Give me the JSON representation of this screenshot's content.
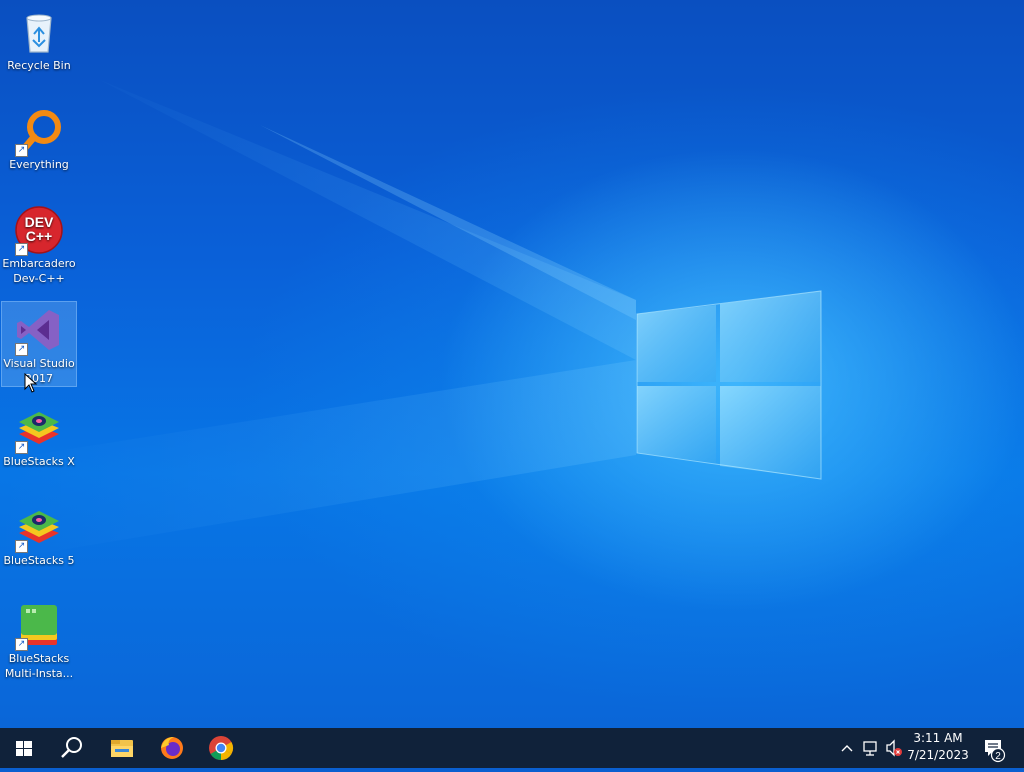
{
  "desktop": {
    "icons": [
      {
        "label": "Recycle Bin",
        "icon": "recycle-bin-icon",
        "shortcut": false
      },
      {
        "label": "Everything",
        "icon": "everything-search-icon",
        "shortcut": true
      },
      {
        "label": "Embarcadero Dev-C++",
        "icon_text": "DEV C++",
        "icon": "devcpp-icon",
        "shortcut": true
      },
      {
        "label": "Visual Studio 2017",
        "icon": "visual-studio-icon",
        "shortcut": true,
        "selected": true
      },
      {
        "label": "BlueStacks X",
        "icon": "bluestacks-icon",
        "shortcut": true
      },
      {
        "label": "BlueStacks 5",
        "icon": "bluestacks-icon",
        "shortcut": true
      },
      {
        "label": "BlueStacks Multi-Insta...",
        "icon": "bluestacks-multi-instance-icon",
        "shortcut": true
      }
    ]
  },
  "taskbar": {
    "buttons": [
      "start-button",
      "search-button",
      "file-explorer-button",
      "firefox-button",
      "chrome-button"
    ],
    "tray": {
      "time": "3:11 AM",
      "date": "7/21/2023",
      "notification_count": "2"
    }
  },
  "colors": {
    "taskbar": "#10223a",
    "wallpaper_blue": "#0a60d8",
    "accent": "#58c0ff"
  }
}
